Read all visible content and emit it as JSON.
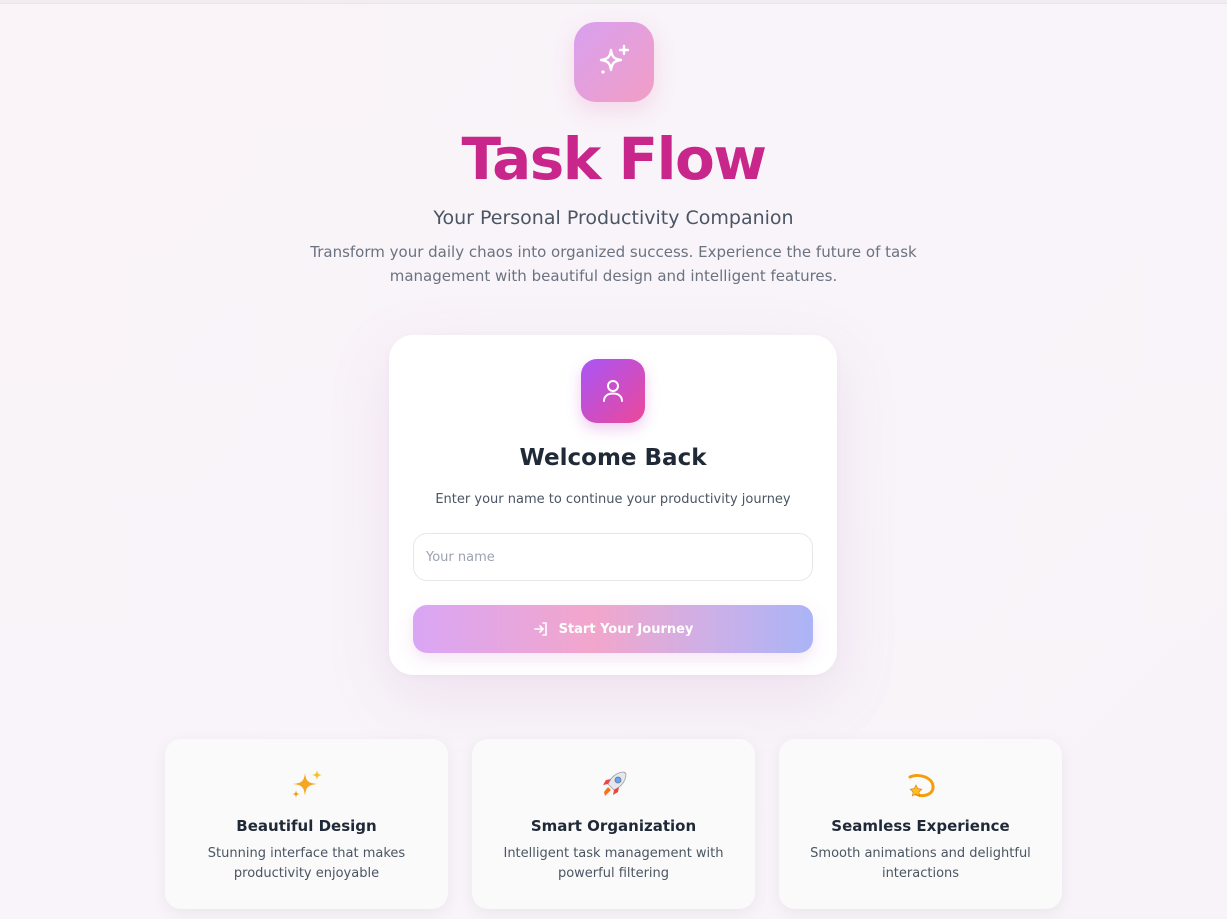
{
  "header": {
    "title": "Task Flow",
    "subtitle": "Your Personal Productivity Companion",
    "description": "Transform your daily chaos into organized success. Experience the future of task management with beautiful design and intelligent features.",
    "logo_icon": "sparkles-icon"
  },
  "login": {
    "icon": "user-icon",
    "heading": "Welcome Back",
    "prompt": "Enter your name to continue your productivity journey",
    "name_input": {
      "placeholder": "Your name",
      "value": ""
    },
    "button_label": "Start Your Journey",
    "button_icon": "log-in-icon"
  },
  "features": [
    {
      "icon": "sparkles-emoji-icon",
      "title": "Beautiful Design",
      "description": "Stunning interface that makes productivity enjoyable"
    },
    {
      "icon": "rocket-emoji-icon",
      "title": "Smart Organization",
      "description": "Intelligent task management with powerful filtering"
    },
    {
      "icon": "dizzy-star-emoji-icon",
      "title": "Seamless Experience",
      "description": "Smooth animations and delightful interactions"
    }
  ],
  "colors": {
    "title": "#c8268a",
    "accent_purple": "#a855f7",
    "accent_pink": "#ec4899"
  }
}
